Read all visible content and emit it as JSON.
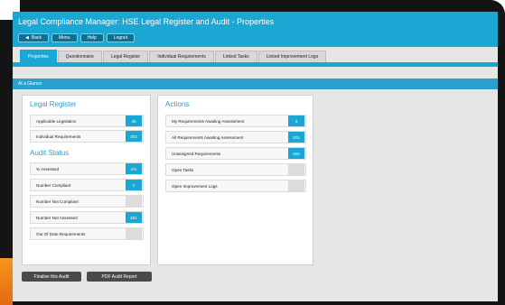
{
  "app": {
    "title": "Legal Compliance Manager: HSE Legal Register and Audit - Properties",
    "nav_buttons": [
      {
        "label": "Back"
      },
      {
        "label": "Menu"
      },
      {
        "label": "Help"
      },
      {
        "label": "Logout"
      }
    ]
  },
  "tabs": [
    {
      "label": "Properties",
      "active": true
    },
    {
      "label": "Questionnaire"
    },
    {
      "label": "Legal Register"
    },
    {
      "label": "Individual Requirements"
    },
    {
      "label": "Linked Tasks"
    },
    {
      "label": "Linked Improvement Logs"
    }
  ],
  "glance": {
    "label": "At a Glance"
  },
  "legal_register": {
    "heading": "Legal Register",
    "rows": [
      {
        "label": "Applicable Legislation",
        "value": "45"
      },
      {
        "label": "Individual Requirements",
        "value": "203"
      }
    ]
  },
  "audit_status": {
    "heading": "Audit Status",
    "rows": [
      {
        "label": "% Assessed",
        "value": "1%"
      },
      {
        "label": "Number Compliant",
        "value": "2"
      },
      {
        "label": "Number Not Compliant",
        "value": "0"
      },
      {
        "label": "Number Not Assessed",
        "value": "201"
      },
      {
        "label": "Out Of Date Requirements",
        "value": "0"
      }
    ]
  },
  "actions": {
    "heading": "Actions",
    "rows": [
      {
        "label": "My Requirements Awaiting Assessment",
        "value": "3"
      },
      {
        "label": "All Requirements Awaiting Assessment",
        "value": "201"
      },
      {
        "label": "Unassigned Requirements",
        "value": "200"
      },
      {
        "label": "Open Tasks",
        "value": "0"
      },
      {
        "label": "Open Improvement Logs",
        "value": "0"
      }
    ]
  },
  "footer": {
    "finalise_label": "Finalise this Audit",
    "pdf_label": "PDF Audit Report"
  },
  "colors": {
    "accent": "#1aa7d3",
    "heading": "#2a9fd0",
    "dark_button": "#4a4a4a",
    "bezel": "#141414"
  }
}
